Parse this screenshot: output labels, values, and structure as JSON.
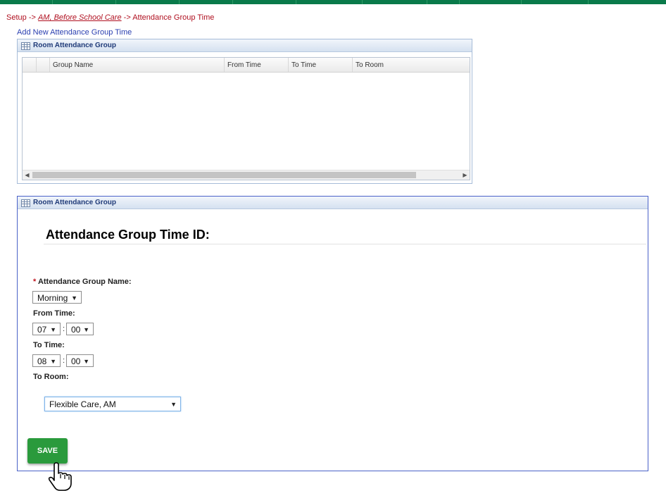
{
  "breadcrumb": {
    "root": "Setup",
    "sep1": "->",
    "middle": "AM, Before School Care",
    "sep2": "->",
    "current": "Attendance Group Time"
  },
  "add_link": "Add New Attendance Group Time",
  "grid_panel": {
    "title": "Room Attendance Group",
    "icon": "grid-icon",
    "columns": [
      "Group Name",
      "From Time",
      "To Time",
      "To Room"
    ],
    "rows": []
  },
  "form_panel": {
    "title": "Room Attendance Group",
    "icon": "grid-icon",
    "heading": "Attendance Group Time ID:",
    "required_mark": "*",
    "group_name_label": "Attendance Group Name:",
    "group_name_value": "Morning",
    "from_label": "From Time:",
    "from_hour": "07",
    "from_minute": "00",
    "to_label": "To Time:",
    "to_hour": "08",
    "to_minute": "00",
    "time_sep": ":",
    "room_label": "To Room:",
    "room_value": "Flexible Care, AM",
    "save_label": "SAVE"
  },
  "colors": {
    "top_bar": "#0a7a4a",
    "breadcrumb": "#b01020",
    "link": "#2a3fb0",
    "save_button": "#2a9a3c",
    "panel_border": "#4a62c8"
  }
}
